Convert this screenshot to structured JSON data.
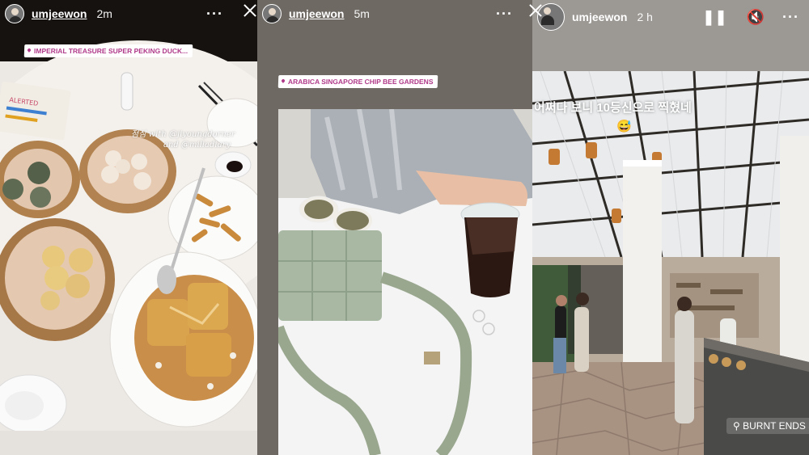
{
  "stories": [
    {
      "username": "umjeewon",
      "time": "2m",
      "location": "IMPERIAL TREASURE SUPER PEKING DUCK...",
      "caption_lines": [
        "점심 with @jiyoungdorner",
        "and @milladiary"
      ],
      "more_icon": "more-dots-icon",
      "close_icon": "close-icon"
    },
    {
      "username": "umjeewon",
      "time": "5m",
      "location": "ARABICA SINGAPORE CHIP BEE GARDENS",
      "more_icon": "more-dots-icon",
      "close_icon": "close-icon"
    },
    {
      "username": "umjeewon",
      "time": "2 h",
      "caption": "어쩌다 보니 10등신으로 찍혔네",
      "caption_emoji": "😅",
      "location": "BURNT ENDS SG",
      "pause_icon": "pause-icon",
      "mute_icon": "mute-icon",
      "more_icon": "more-dots-icon"
    }
  ],
  "colors": {
    "sticker_text": "#b03a8a",
    "header_text": "#ffffff"
  }
}
